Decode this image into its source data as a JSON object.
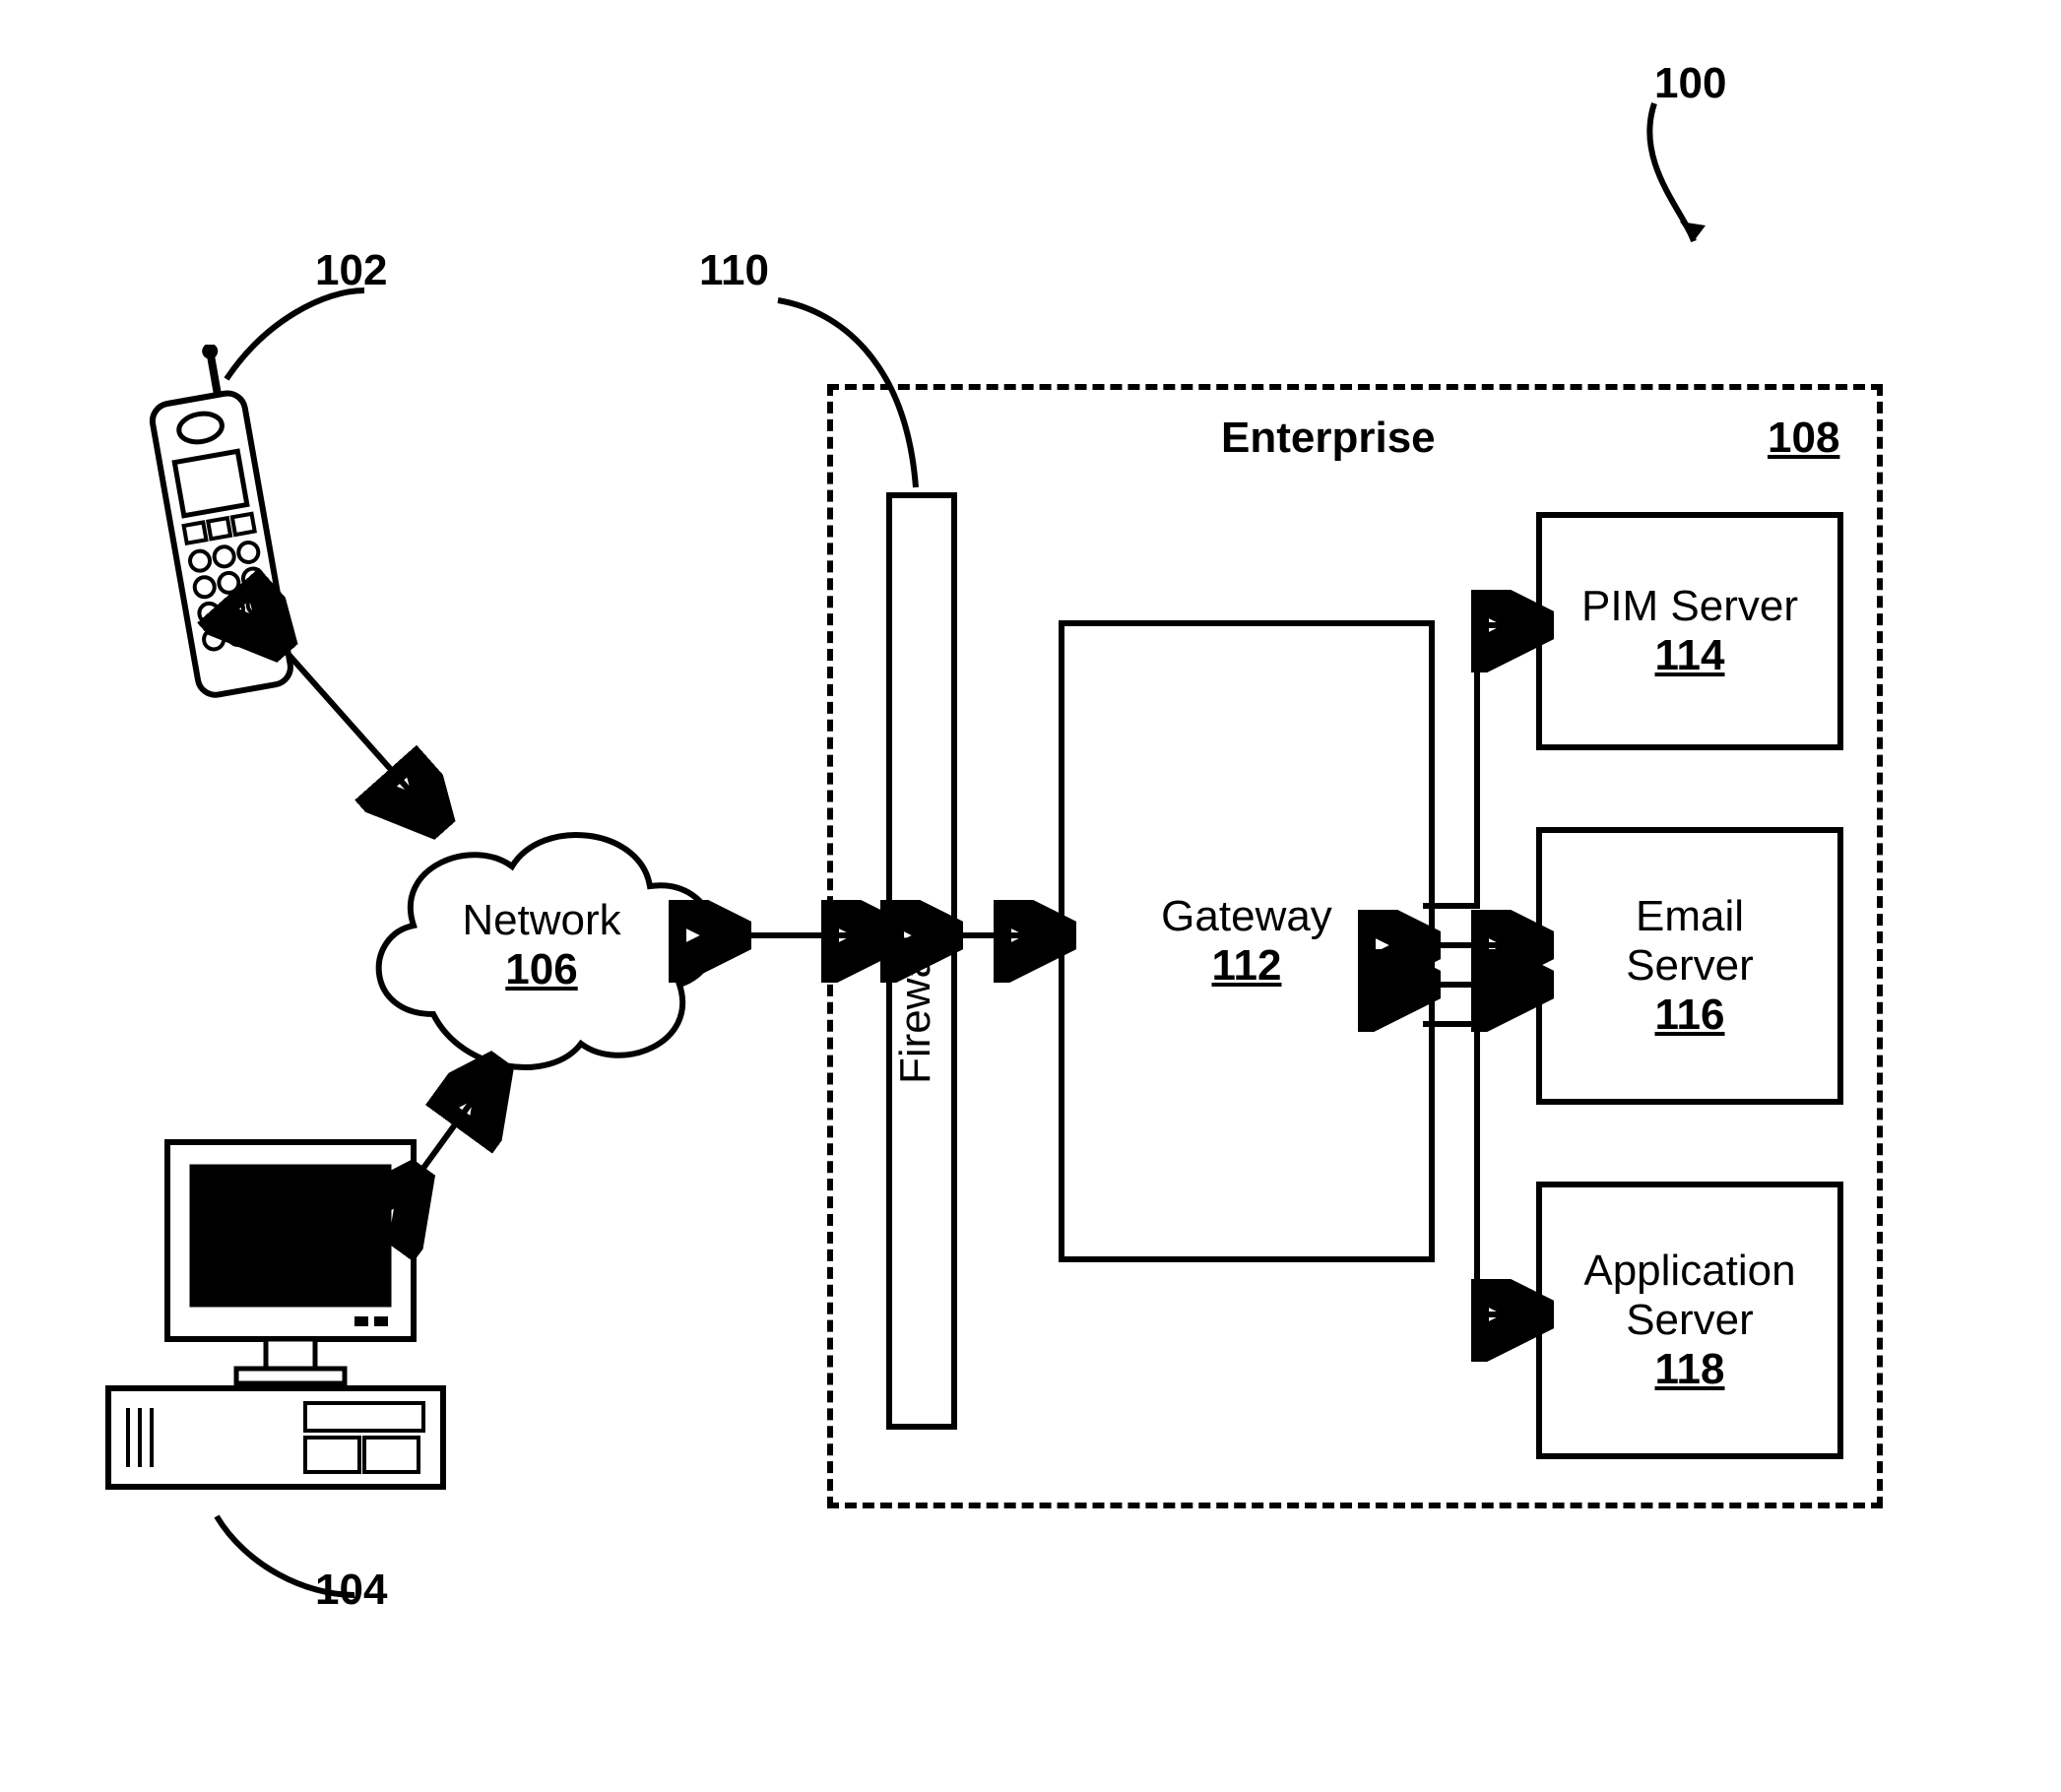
{
  "figure": {
    "ref_100": "100",
    "ref_102": "102",
    "ref_104": "104",
    "ref_106": "106",
    "ref_108": "108",
    "ref_110": "110",
    "ref_112": "112",
    "ref_114": "114",
    "ref_116": "116",
    "ref_118": "118"
  },
  "labels": {
    "enterprise": "Enterprise",
    "network": "Network",
    "firewall": "Firewall",
    "gateway": "Gateway",
    "pim_server": "PIM Server",
    "email_server_line1": "Email",
    "email_server_line2": "Server",
    "app_server_line1": "Application",
    "app_server_line2": "Server"
  }
}
